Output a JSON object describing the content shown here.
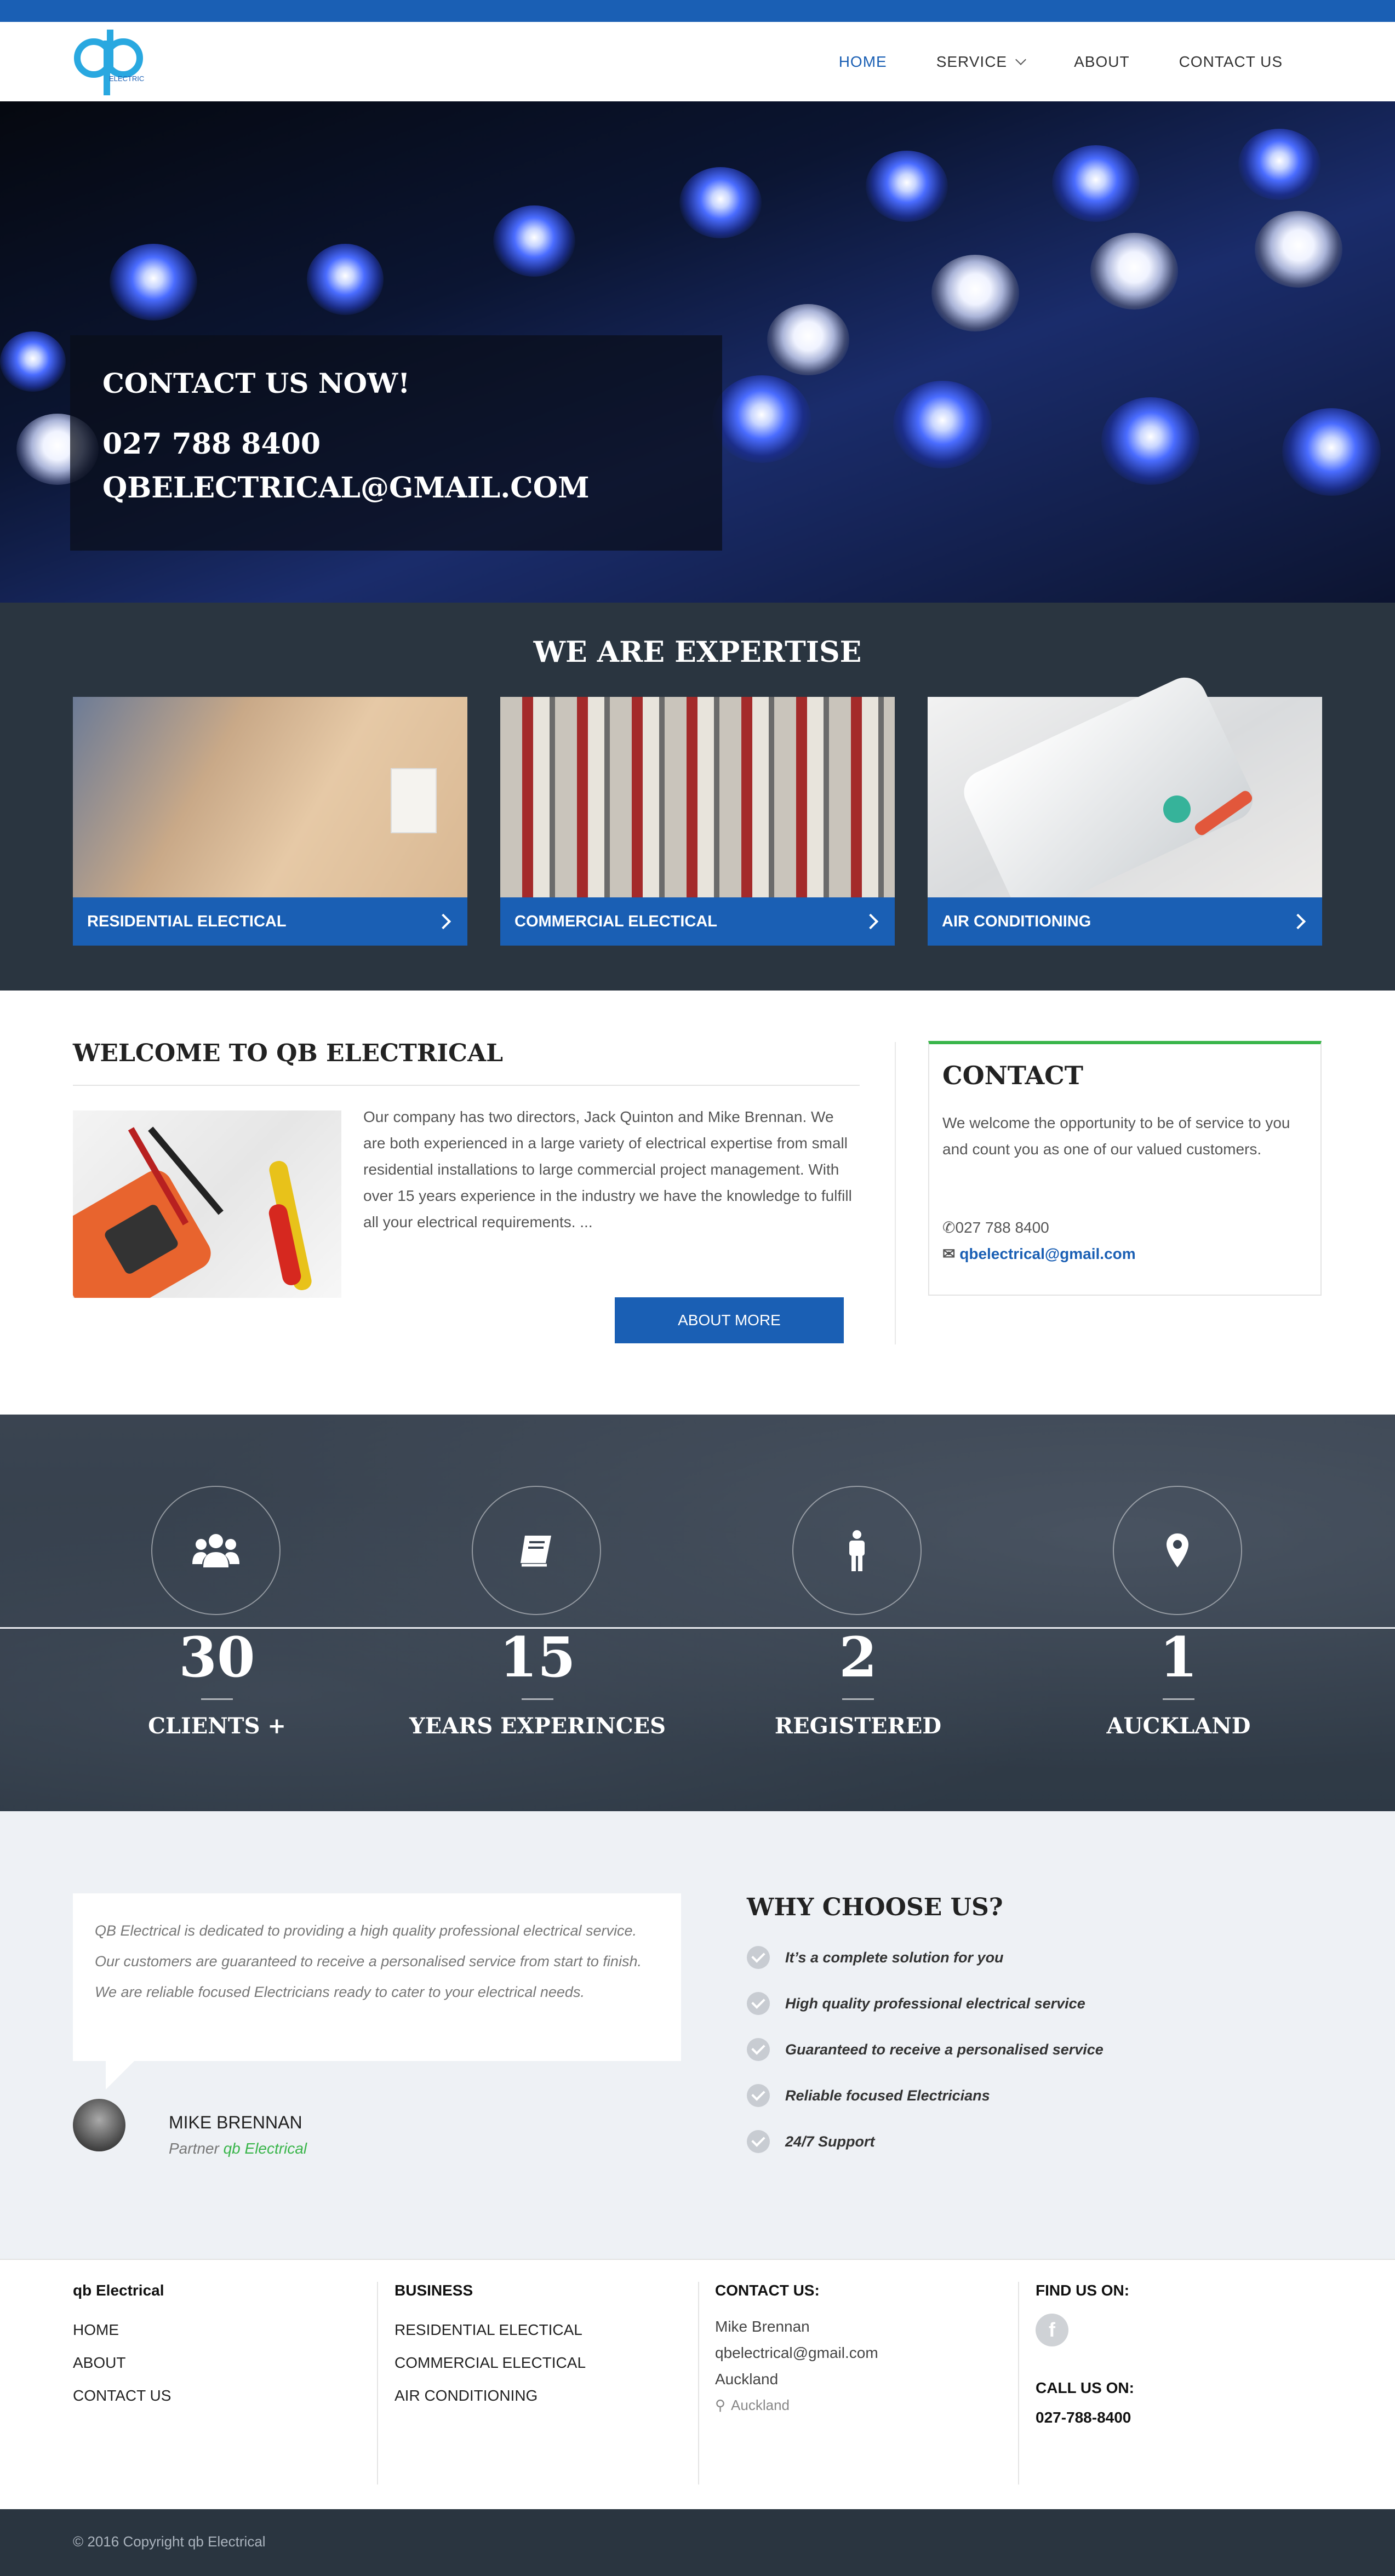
{
  "brand": {
    "logo_text": "ELECTRICAL"
  },
  "nav": {
    "items": [
      "HOME",
      "SERVICE",
      "ABOUT",
      "CONTACT US"
    ]
  },
  "hero": {
    "heading": "CONTACT US NOW!",
    "phone": "027 788 8400",
    "email": "QBELECTRICAL@GMAIL.COM"
  },
  "expertise": {
    "title": "WE ARE EXPERTISE",
    "cards": [
      "RESIDENTIAL ELECTICAL",
      "COMMERCIAL ELECTICAL",
      "AIR CONDITIONING"
    ]
  },
  "welcome": {
    "title": "WELCOME TO QB ELECTRICAL",
    "text": "Our company has two directors, Jack Quinton and Mike Brennan. We are both experienced in a large variety of electrical expertise from small residential installations to large commercial project management. With over 15 years experience in the industry we have the knowledge to fulfill all your electrical requirements. ...",
    "button": "ABOUT MORE"
  },
  "contact": {
    "title": "CONTACT",
    "text": "We welcome the opportunity to be of service to you and count you as one of our valued customers.",
    "phone": "027 788 8400",
    "email": "qbelectrical@gmail.com"
  },
  "stats": [
    {
      "icon": "users-icon",
      "value": "30",
      "label": "CLIENTS +"
    },
    {
      "icon": "book-icon",
      "value": "15",
      "label": "YEARS EXPERINCES"
    },
    {
      "icon": "person-icon",
      "value": "2",
      "label": "REGISTERED"
    },
    {
      "icon": "map-marker-icon",
      "value": "1",
      "label": "AUCKLAND"
    }
  ],
  "testimonial": {
    "quote": "QB Electrical is dedicated to providing a high quality professional electrical service. Our customers are guaranteed to receive a personalised service from start to finish. We are reliable focused Electricians ready to cater to your electrical needs.",
    "name": "MIKE BRENNAN",
    "role": "Partner",
    "company": "qb Electrical"
  },
  "why": {
    "title": "WHY CHOOSE US?",
    "items": [
      "It’s a complete solution for you",
      "High quality professional electrical service",
      "Guaranteed to receive a personalised service",
      "Reliable focused Electricians",
      "24/7 Support"
    ]
  },
  "footer": {
    "col1": {
      "title": "qb Electrical",
      "links": [
        "HOME",
        "ABOUT",
        "CONTACT US"
      ]
    },
    "col2": {
      "title": "BUSINESS",
      "links": [
        "RESIDENTIAL ELECTICAL",
        "COMMERCIAL ELECTICAL",
        "AIR CONDITIONING"
      ]
    },
    "col3": {
      "title": "CONTACT US:",
      "lines": [
        "Mike Brennan",
        "qbelectrical@gmail.com",
        "Auckland"
      ],
      "location": "Auckland"
    },
    "col4": {
      "find_title": "FIND US ON:",
      "facebook": "f",
      "call_title": "CALL US ON:",
      "phone": "027-788-8400"
    }
  },
  "copyright": "© 2016 Copyright qb Electrical",
  "colors": {
    "primary": "#1a5fb4",
    "accent": "#39b54a",
    "dark": "#2a3540"
  }
}
